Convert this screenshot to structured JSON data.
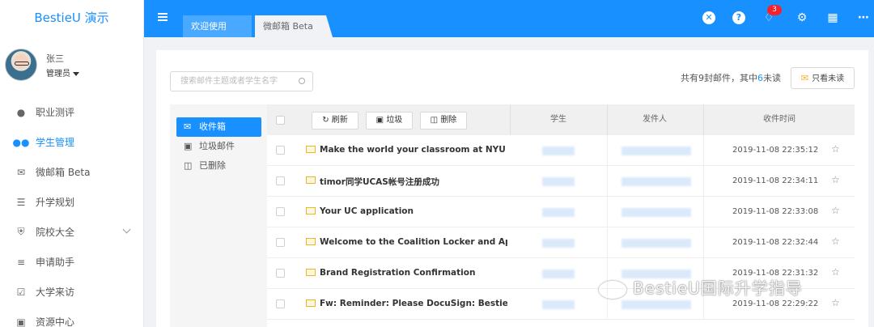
{
  "app": {
    "title": "BestieU 演示"
  },
  "user": {
    "name": "张三",
    "role": "管理员"
  },
  "sidebar": {
    "items": [
      {
        "label": "职业测评",
        "icon": "person-icon"
      },
      {
        "label": "学生管理",
        "icon": "users-icon",
        "active": true
      },
      {
        "label": "微邮箱 Beta",
        "icon": "mail-icon"
      },
      {
        "label": "升学规划",
        "icon": "list-icon"
      },
      {
        "label": "院校大全",
        "icon": "institution-icon"
      },
      {
        "label": "申请助手",
        "icon": "tasks-icon"
      },
      {
        "label": "大学来访",
        "icon": "calendar-check-icon"
      },
      {
        "label": "资源中心",
        "icon": "briefcase-icon"
      }
    ]
  },
  "header": {
    "tabs": [
      "欢迎使用",
      "微邮箱 Beta"
    ],
    "notification_count": "3",
    "icons": [
      "close-circle-icon",
      "help-icon",
      "bell-icon",
      "gear-icon",
      "calendar-icon",
      "more-icon"
    ]
  },
  "mailbox": {
    "search_placeholder": "搜索邮件主题或者学生名字",
    "summary_prefix": "共有9封邮件，其中",
    "unread_count": "6",
    "summary_suffix": "未读",
    "unread_only_label": "只看未读",
    "folders": [
      {
        "label": "收件箱",
        "active": true
      },
      {
        "label": "垃圾邮件"
      },
      {
        "label": "已删除"
      }
    ],
    "toolbar": {
      "refresh": "刷新",
      "junk": "垃圾",
      "delete": "删除"
    },
    "columns": {
      "student": "学生",
      "sender": "发件人",
      "received": "收件时间"
    },
    "rows": [
      {
        "subject": "Make the world your classroom at NYU",
        "time": "2019-11-08 22:35:12"
      },
      {
        "subject": "timor同学UCAS帐号注册成功",
        "time": "2019-11-08 22:34:11"
      },
      {
        "subject": "Your UC application",
        "time": "2019-11-08 22:33:08"
      },
      {
        "subject": "Welcome to the Coalition Locker and Applicati",
        "time": "2019-11-08 22:32:44"
      },
      {
        "subject": "Brand Registration Confirmation",
        "time": "2019-11-08 22:31:32"
      },
      {
        "subject": "Fw: Reminder: Please DocuSign: BestieU - Unif",
        "time": "2019-11-08 22:29:22"
      }
    ]
  },
  "watermark": {
    "text": "BestieU国际升学指导"
  },
  "colors": {
    "primary": "#1890ff",
    "badge": "#f5222d",
    "mail_icon": "#f0b429"
  }
}
